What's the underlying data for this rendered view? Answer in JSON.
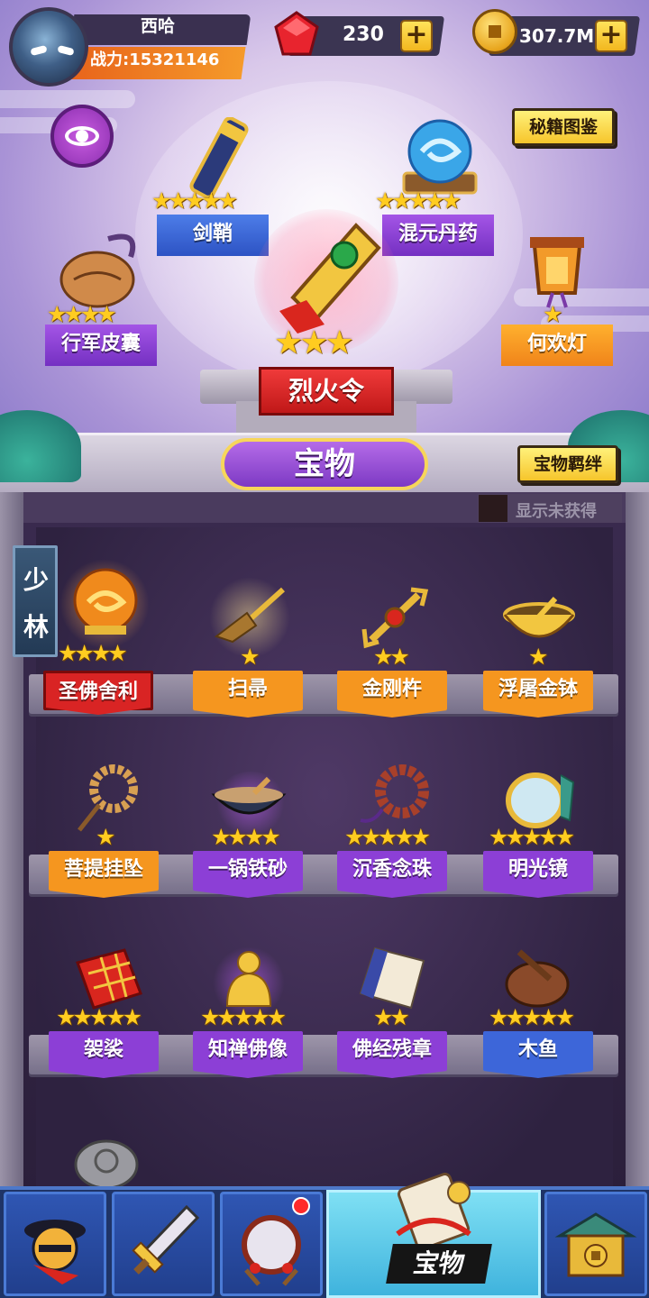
{
  "player": {
    "name": "西哈",
    "power_label": "战力:15321146"
  },
  "currency": {
    "gems": "230",
    "coins": "307.7M",
    "plus": "+"
  },
  "header_buttons": {
    "codex": "秘籍图鉴",
    "bond": "宝物羁绊"
  },
  "featured": {
    "center": {
      "name": "烈火令",
      "stars": 3
    },
    "items": [
      {
        "name": "剑鞘",
        "stars": 5,
        "color": "blue"
      },
      {
        "name": "混元丹药",
        "stars": 5,
        "color": "purple"
      },
      {
        "name": "行军皮囊",
        "stars": 4,
        "color": "purple"
      },
      {
        "name": "何欢灯",
        "stars": 1,
        "color": "orange"
      }
    ]
  },
  "section_title": "宝物",
  "toggle_label": "显示未获得",
  "sect_tab": "少林",
  "shelves": [
    [
      {
        "name": "圣佛舍利",
        "stars": 4,
        "color": "red",
        "icon": "relic-orb-icon"
      },
      {
        "name": "扫帚",
        "stars": 1,
        "color": "orange",
        "icon": "broom-icon"
      },
      {
        "name": "金刚杵",
        "stars": 2,
        "color": "orange",
        "icon": "vajra-icon"
      },
      {
        "name": "浮屠金钵",
        "stars": 1,
        "color": "orange",
        "icon": "golden-bowl-icon"
      }
    ],
    [
      {
        "name": "菩提挂坠",
        "stars": 1,
        "color": "orange",
        "icon": "bead-pendant-icon"
      },
      {
        "name": "一锅铁砂",
        "stars": 4,
        "color": "purple",
        "icon": "iron-sand-wok-icon"
      },
      {
        "name": "沉香念珠",
        "stars": 5,
        "color": "purple",
        "icon": "prayer-beads-icon"
      },
      {
        "name": "明光镜",
        "stars": 5,
        "color": "purple",
        "icon": "mirror-icon"
      }
    ],
    [
      {
        "name": "袈裟",
        "stars": 5,
        "color": "purple",
        "icon": "robe-icon"
      },
      {
        "name": "知禅佛像",
        "stars": 5,
        "color": "purple",
        "icon": "buddha-statue-icon"
      },
      {
        "name": "佛经残章",
        "stars": 2,
        "color": "purple",
        "icon": "scripture-icon"
      },
      {
        "name": "木鱼",
        "stars": 5,
        "color": "blue",
        "icon": "wooden-fish-icon"
      }
    ]
  ],
  "nav": {
    "tabs": [
      "hero-icon",
      "weapon-icon",
      "drum-icon",
      "treasure-icon",
      "building-icon"
    ],
    "active_label": "宝物"
  },
  "colors": {
    "red": "#d92424",
    "orange": "#f5961f",
    "purple": "#8c3fd6",
    "blue": "#3d66d9"
  }
}
